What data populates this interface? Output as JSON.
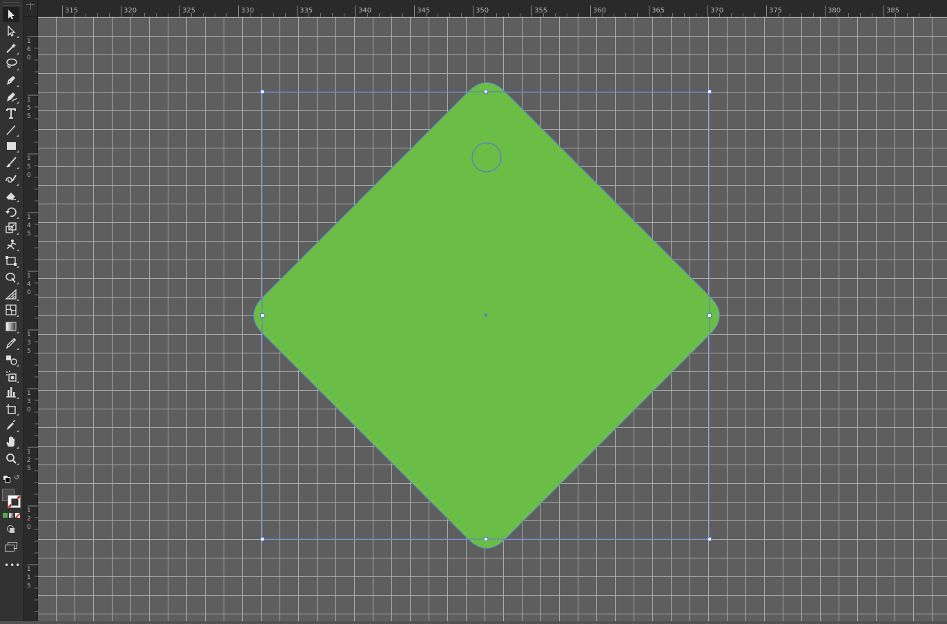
{
  "ruler_top_labels": [
    "315",
    "320",
    "325",
    "330",
    "335",
    "340",
    "345",
    "350",
    "355",
    "360",
    "365",
    "370",
    "375",
    "380",
    "385"
  ],
  "ruler_left_labels": [
    "160",
    "155",
    "150",
    "145",
    "140",
    "135",
    "130",
    "125",
    "120",
    "115"
  ],
  "tools": [
    {
      "name": "selection-tool",
      "icon": "arrow-icon",
      "active": true
    },
    {
      "name": "direct-selection-tool",
      "icon": "white-arrow-icon"
    },
    {
      "name": "magic-wand-tool",
      "icon": "magic-wand-icon"
    },
    {
      "name": "lasso-tool",
      "icon": "lasso-icon"
    },
    {
      "name": "pen-tool",
      "icon": "pen-icon"
    },
    {
      "name": "curvature-tool",
      "icon": "curvature-pen-icon"
    },
    {
      "name": "type-tool",
      "icon": "type-icon"
    },
    {
      "name": "line-segment-tool",
      "icon": "line-icon"
    },
    {
      "name": "rectangle-tool",
      "icon": "rectangle-icon"
    },
    {
      "name": "paintbrush-tool",
      "icon": "paintbrush-icon"
    },
    {
      "name": "shaper-tool",
      "icon": "shaper-icon"
    },
    {
      "name": "eraser-tool",
      "icon": "eraser-icon"
    },
    {
      "name": "rotate-tool",
      "icon": "rotate-icon"
    },
    {
      "name": "scale-tool",
      "icon": "scale-icon"
    },
    {
      "name": "puppet-warp-tool",
      "icon": "puppet-warp-icon"
    },
    {
      "name": "free-transform-tool",
      "icon": "free-transform-icon"
    },
    {
      "name": "shape-builder-tool",
      "icon": "shape-builder-icon"
    },
    {
      "name": "perspective-grid-tool",
      "icon": "perspective-grid-icon"
    },
    {
      "name": "mesh-tool",
      "icon": "mesh-icon"
    },
    {
      "name": "gradient-tool",
      "icon": "gradient-icon"
    },
    {
      "name": "eyedropper-tool",
      "icon": "eyedropper-icon"
    },
    {
      "name": "blend-tool",
      "icon": "blend-icon"
    },
    {
      "name": "symbol-sprayer-tool",
      "icon": "symbol-sprayer-icon"
    },
    {
      "name": "column-graph-tool",
      "icon": "column-graph-icon"
    },
    {
      "name": "artboard-tool",
      "icon": "artboard-icon"
    },
    {
      "name": "slice-tool",
      "icon": "slice-icon"
    },
    {
      "name": "hand-tool",
      "icon": "hand-icon"
    },
    {
      "name": "zoom-tool",
      "icon": "zoom-icon"
    }
  ],
  "fill_stroke": {
    "fill_label": "?",
    "fill": "none",
    "stroke": "red-slash"
  },
  "shape": {
    "fill_color": "#6abd45",
    "selection_color": "#5b7bd6"
  }
}
